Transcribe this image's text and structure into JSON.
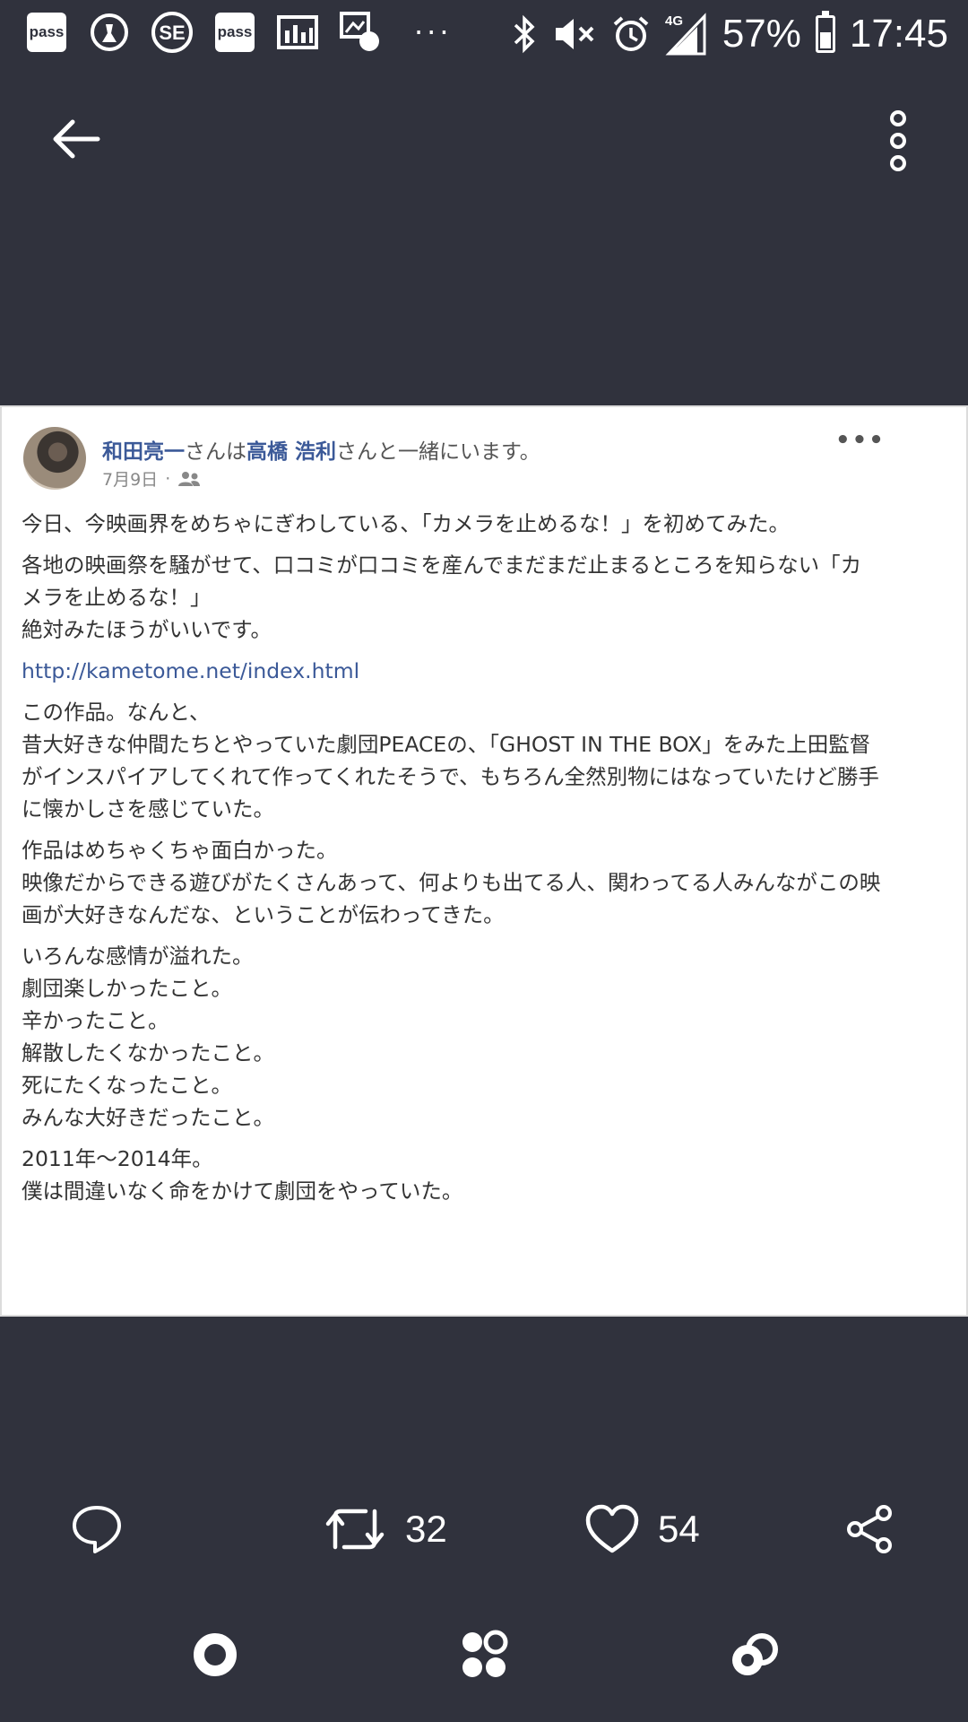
{
  "status_bar": {
    "left_icons": [
      "pass-icon",
      "broom-icon",
      "se-icon",
      "pass-icon",
      "image-gallery-icon",
      "image-notification-icon"
    ],
    "pass_label": "pass",
    "se_label": "SE",
    "overflow": "···",
    "network": "4G",
    "battery": "57%",
    "battery_level": 0.57,
    "time": "17:45"
  },
  "post": {
    "author": "和田亮一",
    "header_mid": "さんは",
    "tagged": "高橋 浩利",
    "header_end": "さんと一緒にいます。",
    "date": "7月9日",
    "date_sep": "·",
    "paragraphs": [
      "今日、今映画界をめちゃにぎわしている、「カメラを止めるな！」を初めてみた。",
      "各地の映画祭を騒がせて、口コミが口コミを産んでまだまだ止まるところを知らない「カメラを止めるな！」\n絶対みたほうがいいです。"
    ],
    "link": "http://kametome.net/index.html",
    "paragraphs_after": [
      "この作品。なんと、\n昔大好きな仲間たちとやっていた劇団PEACEの、「GHOST IN THE BOX」をみた上田監督がインスパイアしてくれて作ってくれたそうで、もちろん全然別物にはなっていたけど勝手に懐かしさを感じていた。",
      "作品はめちゃくちゃ面白かった。\n映像だからできる遊びがたくさんあって、何よりも出てる人、関わってる人みんながこの映画が大好きなんだな、ということが伝わってきた。",
      "いろんな感情が溢れた。\n劇団楽しかったこと。\n辛かったこと。\n解散したくなかったこと。\n死にたくなったこと。\nみんな大好きだったこと。",
      "2011年〜2014年。\n僕は間違いなく命をかけて劇団をやっていた。"
    ]
  },
  "actions": {
    "retweet_count": "32",
    "like_count": "54"
  }
}
